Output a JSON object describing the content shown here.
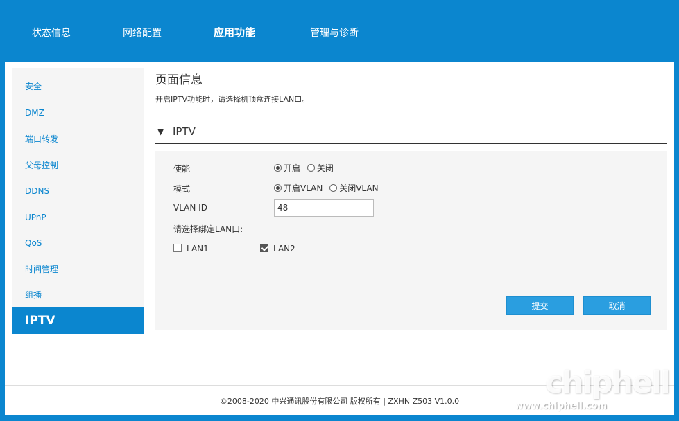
{
  "topnav": {
    "items": [
      {
        "label": "状态信息",
        "active": false
      },
      {
        "label": "网络配置",
        "active": false
      },
      {
        "label": "应用功能",
        "active": true
      },
      {
        "label": "管理与诊断",
        "active": false
      }
    ]
  },
  "sidebar": {
    "items": [
      {
        "label": "安全"
      },
      {
        "label": "DMZ"
      },
      {
        "label": "端口转发"
      },
      {
        "label": "父母控制"
      },
      {
        "label": "DDNS"
      },
      {
        "label": "UPnP"
      },
      {
        "label": "QoS"
      },
      {
        "label": "时间管理"
      },
      {
        "label": "组播"
      },
      {
        "label": "IPTV",
        "active": true
      }
    ]
  },
  "page": {
    "title": "页面信息",
    "description": "开启IPTV功能时，请选择机顶盒连接LAN口。",
    "section_title": "IPTV"
  },
  "form": {
    "enable": {
      "label": "使能",
      "options": [
        "开启",
        "关闭"
      ],
      "selected": "开启"
    },
    "mode": {
      "label": "模式",
      "options": [
        "开启VLAN",
        "关闭VLAN"
      ],
      "selected": "开启VLAN"
    },
    "vlan_id": {
      "label": "VLAN ID",
      "value": "48"
    },
    "lan_bind_label": "请选择绑定LAN口:",
    "lan_ports": [
      {
        "label": "LAN1",
        "checked": false
      },
      {
        "label": "LAN2",
        "checked": true
      }
    ],
    "submit_label": "提交",
    "cancel_label": "取消"
  },
  "footer": {
    "text": "©2008-2020 中兴通讯股份有限公司 版权所有  |   ZXHN Z503 V1.0.0"
  },
  "watermark": {
    "logo": "chiphell",
    "url": "www.chiphell.com"
  },
  "colors": {
    "brand_blue": "#0b86cf",
    "button_blue": "#2a9ee0"
  }
}
